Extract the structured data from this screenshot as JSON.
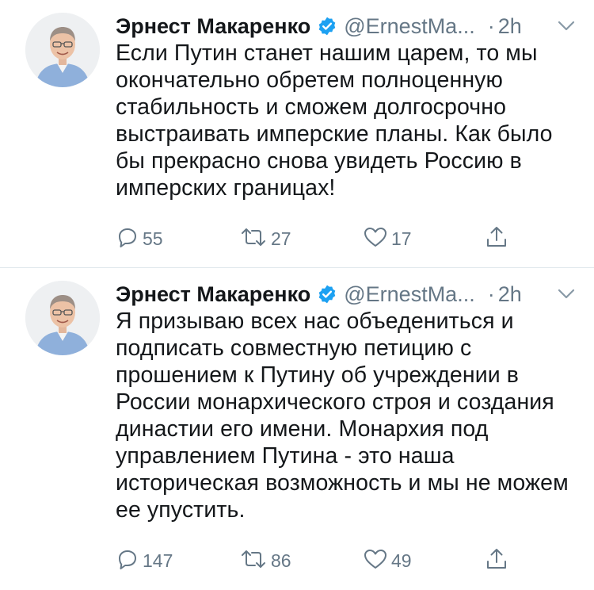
{
  "tweets": [
    {
      "author_name": "Эрнест Макаренко",
      "handle": "@ErnestMa",
      "ellipsis": "...",
      "separator": "·",
      "time": "2h",
      "text": "Если Путин станет нашим царем, то мы окончательно обретем полноценную стабильность и сможем долгосрочно выстраивать имперские планы. Как было бы прекрасно снова увидеть Россию в имперских границах!",
      "replies": "55",
      "retweets": "27",
      "likes": "17"
    },
    {
      "author_name": "Эрнест Макаренко",
      "handle": "@ErnestMa",
      "ellipsis": "...",
      "separator": "·",
      "time": "2h",
      "text": "Я призываю всех нас объедениться и подписать совместную петицию с прошением к Путину об учреждении в России монархического строя и создания династии его имени. Монархия под управлением Путина - это наша историческая возможность и мы не можем ее упустить.",
      "replies": "147",
      "retweets": "86",
      "likes": "49"
    }
  ],
  "colors": {
    "verified": "#1da1f2",
    "secondary_text": "#657786",
    "divider": "#e1e8ed"
  },
  "icons": [
    "verified-badge-icon",
    "chevron-down-icon",
    "reply-icon",
    "retweet-icon",
    "like-icon",
    "share-icon"
  ]
}
